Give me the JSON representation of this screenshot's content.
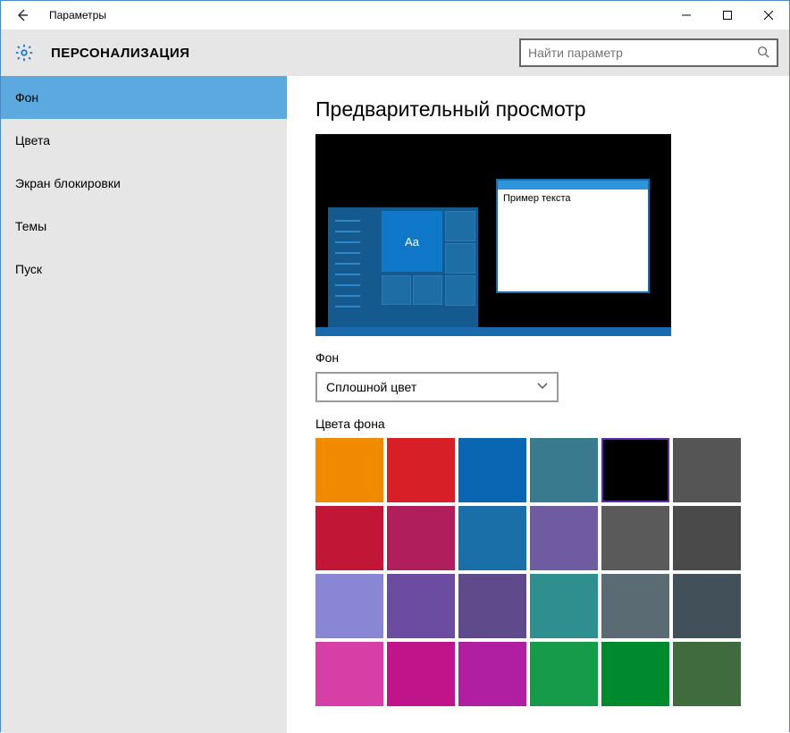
{
  "window": {
    "title": "Параметры"
  },
  "header": {
    "title": "ПЕРСОНАЛИЗАЦИЯ",
    "search_placeholder": "Найти параметр"
  },
  "sidebar": {
    "items": [
      {
        "label": "Фон",
        "active": true
      },
      {
        "label": "Цвета",
        "active": false
      },
      {
        "label": "Экран блокировки",
        "active": false
      },
      {
        "label": "Темы",
        "active": false
      },
      {
        "label": "Пуск",
        "active": false
      }
    ]
  },
  "main": {
    "preview_heading": "Предварительный просмотр",
    "preview_sample_text": "Пример текста",
    "preview_tile_text": "Aa",
    "background_section_label": "Фон",
    "background_dropdown_value": "Сплошной цвет",
    "colors_section_label": "Цвета фона",
    "colors": [
      "#f28a00",
      "#d71f27",
      "#0a66b3",
      "#3a7a8f",
      "#000000",
      "#555555",
      "#c21636",
      "#b01f5c",
      "#1b6fa8",
      "#6f5ba0",
      "#5a5a5a",
      "#4a4a4a",
      "#8a86d6",
      "#6b4ca0",
      "#5f4b8b",
      "#2f8f8f",
      "#5a6b73",
      "#425159",
      "#d63fa6",
      "#c0148b",
      "#b01fa0",
      "#169b4b",
      "#008a2e",
      "#3f6b3f"
    ],
    "selected_color_index": 4
  }
}
